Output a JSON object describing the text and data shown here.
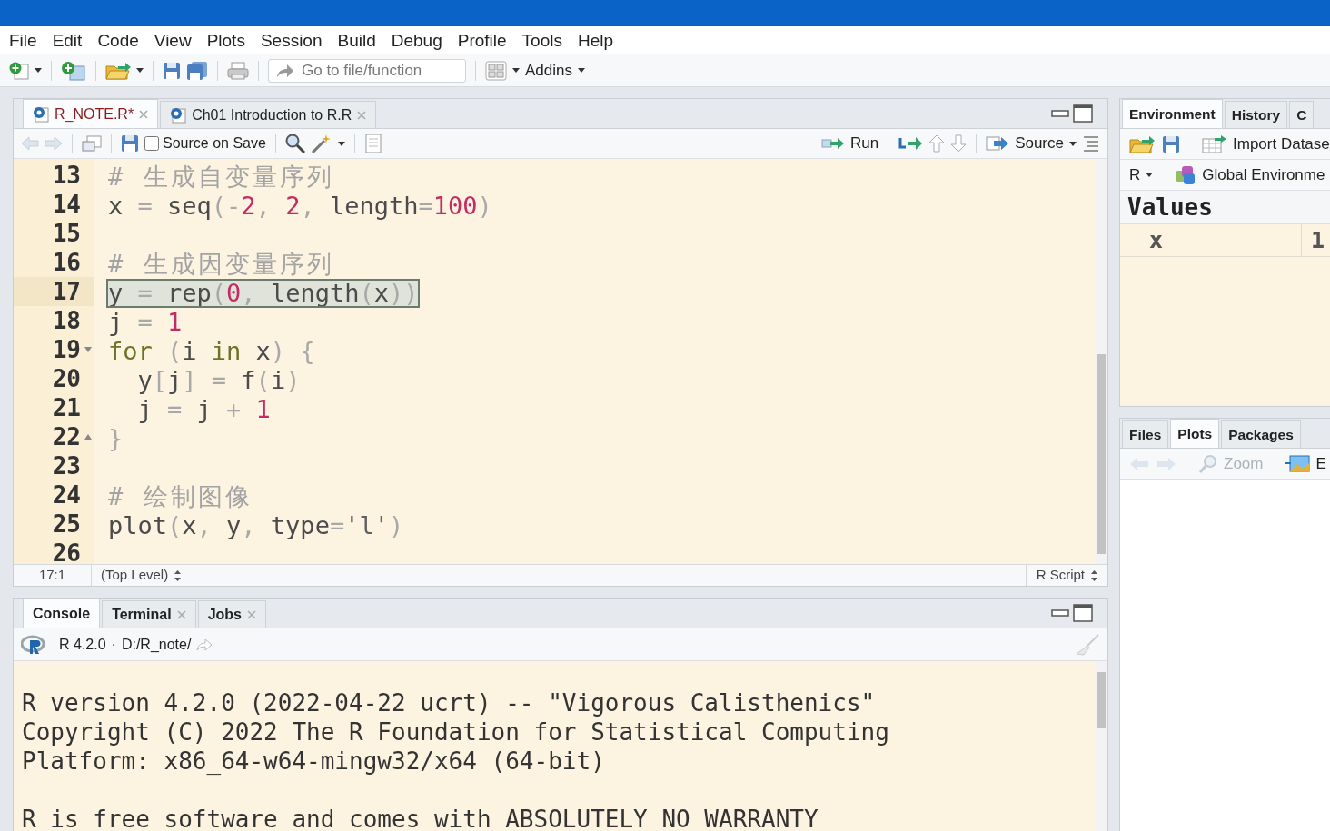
{
  "menu": [
    "File",
    "Edit",
    "Code",
    "View",
    "Plots",
    "Session",
    "Build",
    "Debug",
    "Profile",
    "Tools",
    "Help"
  ],
  "toolbar": {
    "goto_placeholder": "Go to file/function",
    "addins": "Addins"
  },
  "editor": {
    "tabs": [
      {
        "label": "R_NOTE.R*",
        "selected": true,
        "modified": true
      },
      {
        "label": "Ch01 Introduction to R.R",
        "selected": false,
        "modified": false
      }
    ],
    "source_on_save": {
      "label": "Source on Save",
      "checked": false
    },
    "run": "Run",
    "source": "Source",
    "lines": [
      {
        "number": "13",
        "selected": false,
        "tokens": [
          {
            "kind": "comment",
            "text": "# 生成自变量序列"
          }
        ]
      },
      {
        "number": "14",
        "selected": false,
        "tokens": [
          {
            "kind": "plain",
            "text": "x"
          },
          {
            "kind": "op",
            "text": " = "
          },
          {
            "kind": "plain",
            "text": "seq"
          },
          {
            "kind": "op",
            "text": "(-"
          },
          {
            "kind": "num",
            "text": "2"
          },
          {
            "kind": "op",
            "text": ", "
          },
          {
            "kind": "num",
            "text": "2"
          },
          {
            "kind": "op",
            "text": ", "
          },
          {
            "kind": "plain",
            "text": "length"
          },
          {
            "kind": "op",
            "text": "="
          },
          {
            "kind": "num",
            "text": "100"
          },
          {
            "kind": "op",
            "text": ")"
          }
        ]
      },
      {
        "number": "15",
        "selected": false
      },
      {
        "number": "16",
        "selected": false,
        "tokens": [
          {
            "kind": "comment",
            "text": "# 生成因变量序列"
          }
        ]
      },
      {
        "number": "17",
        "selected": true,
        "tokens": [
          {
            "kind": "plain",
            "text": "y"
          },
          {
            "kind": "op",
            "text": " = "
          },
          {
            "kind": "plain",
            "text": "rep"
          },
          {
            "kind": "op",
            "text": "("
          },
          {
            "kind": "num",
            "text": "0"
          },
          {
            "kind": "op",
            "text": ", "
          },
          {
            "kind": "plain",
            "text": "length"
          },
          {
            "kind": "op",
            "text": "("
          },
          {
            "kind": "plain",
            "text": "x"
          },
          {
            "kind": "op",
            "text": "))"
          }
        ]
      },
      {
        "number": "18",
        "selected": false,
        "tokens": [
          {
            "kind": "plain",
            "text": "j"
          },
          {
            "kind": "op",
            "text": " = "
          },
          {
            "kind": "num",
            "text": "1"
          }
        ]
      },
      {
        "number": "19",
        "selected": false,
        "fold_start": true,
        "tokens": [
          {
            "kind": "kw",
            "text": "for"
          },
          {
            "kind": "op",
            "text": " ("
          },
          {
            "kind": "plain",
            "text": "i "
          },
          {
            "kind": "kw",
            "text": "in"
          },
          {
            "kind": "plain",
            "text": " x"
          },
          {
            "kind": "op",
            "text": ") {"
          }
        ]
      },
      {
        "number": "20",
        "selected": false,
        "tokens": [
          {
            "kind": "plain",
            "text": "  y"
          },
          {
            "kind": "op",
            "text": "["
          },
          {
            "kind": "plain",
            "text": "j"
          },
          {
            "kind": "op",
            "text": "] = "
          },
          {
            "kind": "plain",
            "text": "f"
          },
          {
            "kind": "op",
            "text": "("
          },
          {
            "kind": "plain",
            "text": "i"
          },
          {
            "kind": "op",
            "text": ")"
          }
        ]
      },
      {
        "number": "21",
        "selected": false,
        "tokens": [
          {
            "kind": "plain",
            "text": "  j"
          },
          {
            "kind": "op",
            "text": " = "
          },
          {
            "kind": "plain",
            "text": "j"
          },
          {
            "kind": "op",
            "text": " + "
          },
          {
            "kind": "num",
            "text": "1"
          }
        ]
      },
      {
        "number": "22",
        "selected": false,
        "fold_end": true,
        "tokens": [
          {
            "kind": "op",
            "text": "}"
          }
        ]
      },
      {
        "number": "23",
        "selected": false
      },
      {
        "number": "24",
        "selected": false,
        "tokens": [
          {
            "kind": "comment",
            "text": "# 绘制图像"
          }
        ]
      },
      {
        "number": "25",
        "selected": false,
        "tokens": [
          {
            "kind": "plain",
            "text": "plot"
          },
          {
            "kind": "op",
            "text": "("
          },
          {
            "kind": "plain",
            "text": "x"
          },
          {
            "kind": "op",
            "text": ", "
          },
          {
            "kind": "plain",
            "text": "y"
          },
          {
            "kind": "op",
            "text": ", "
          },
          {
            "kind": "plain",
            "text": "type"
          },
          {
            "kind": "op",
            "text": "="
          },
          {
            "kind": "str",
            "text": "'l'"
          },
          {
            "kind": "op",
            "text": ")"
          }
        ]
      },
      {
        "number": "26",
        "selected": false
      }
    ],
    "status": {
      "position": "17:1",
      "scope": "(Top Level)",
      "file_type": "R Script"
    }
  },
  "console": {
    "tabs": [
      {
        "label": "Console",
        "selected": true,
        "closable": false
      },
      {
        "label": "Terminal",
        "selected": false,
        "closable": true
      },
      {
        "label": "Jobs",
        "selected": false,
        "closable": true
      }
    ],
    "version": "R 4.2.0",
    "separator": "·",
    "path": "D:/R_note/",
    "output": [
      {
        "lines": [
          "R version 4.2.0 (2022-04-22 ucrt) -- \"Vigorous Calisthenics\"",
          "Copyright (C) 2022 The R Foundation for Statistical Computing",
          "Platform: x86_64-w64-mingw32/x64 (64-bit)"
        ]
      },
      {
        "lines": [
          "R is free software and comes with ABSOLUTELY NO WARRANTY"
        ]
      }
    ]
  },
  "environment": {
    "tabs": [
      {
        "label": "Environment",
        "selected": true
      },
      {
        "label": "History",
        "selected": false
      },
      {
        "label": "C",
        "selected": false
      }
    ],
    "import": "Import Datase",
    "language": "R",
    "scope": "Global Environme",
    "section": "Values",
    "rows": [
      {
        "name": "x",
        "value": "1"
      }
    ]
  },
  "files": {
    "tabs": [
      {
        "label": "Files",
        "selected": false
      },
      {
        "label": "Plots",
        "selected": true
      },
      {
        "label": "Packages",
        "selected": false
      }
    ],
    "zoom": "Zoom",
    "export": "E"
  }
}
